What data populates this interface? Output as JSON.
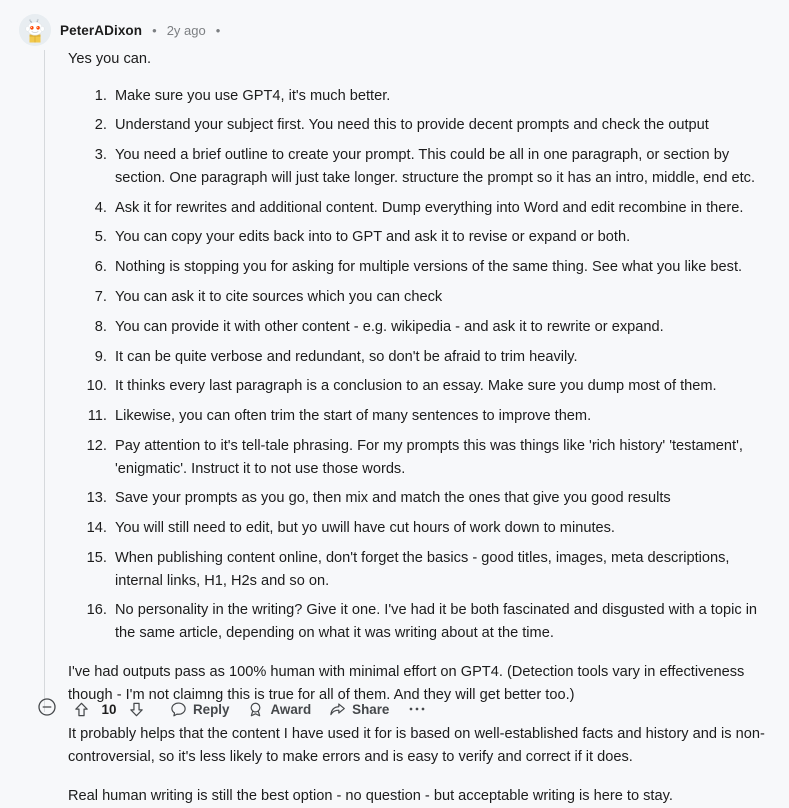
{
  "comment": {
    "author": "PeterADixon",
    "separator": "•",
    "timestamp": "2y ago",
    "avatar_icon": "reddit-snoo-avatar"
  },
  "body": {
    "intro": "Yes you can.",
    "list_items": [
      "Make sure you use GPT4, it's much better.",
      "Understand your subject first. You need this to provide decent prompts and check the output",
      "You need a brief outline to create your prompt. This could be all in one paragraph, or section by section. One paragraph will just take longer. structure the prompt so it has an intro, middle, end etc.",
      "Ask it for rewrites and additional content. Dump everything into Word and edit recombine in there.",
      "You can copy your edits back into to GPT and ask it to revise or expand or both.",
      "Nothing is stopping you for asking for multiple versions of the same thing. See what you like best.",
      "You can ask it to cite sources which you can check",
      "You can provide it with other content - e.g. wikipedia - and ask it to rewrite or expand.",
      "It can be quite verbose and redundant, so don't be afraid to trim heavily.",
      "It thinks every last paragraph is a conclusion to an essay. Make sure you dump most of them.",
      "Likewise, you can often trim the start of many sentences to improve them.",
      "Pay attention to it's tell-tale phrasing. For my prompts this was things like 'rich history' 'testament', 'enigmatic'. Instruct it to not use those words.",
      "Save your prompts as you go, then mix and match the ones that give you good results",
      "You will still need to edit, but yo uwill have cut hours of work down to minutes.",
      "When publishing content online, don't forget the basics - good titles, images, meta descriptions, internal links, H1, H2s and so on.",
      "No personality in the writing? Give it one. I've had it be both fascinated and disgusted with a topic in the same article, depending on what it was writing about at the time."
    ],
    "paragraphs": [
      "I've had outputs pass as 100% human with minimal effort on GPT4. (Detection tools vary in effectiveness though - I'm not claimng this is true for all of them. And they will get better too.)",
      "It probably helps that the content I have used it for is based on well-established facts and history and is non-controversial, so it's less likely to make errors and is easy to verify and correct if it does.",
      "Real human writing is still the best option - no question - but acceptable writing is here to stay."
    ]
  },
  "actions": {
    "collapse_icon": "minus-circle-icon",
    "upvote_icon": "upvote-arrow-icon",
    "downvote_icon": "downvote-arrow-icon",
    "vote_count": "10",
    "reply_label": "Reply",
    "reply_icon": "comment-bubble-icon",
    "award_label": "Award",
    "award_icon": "award-medal-icon",
    "share_label": "Share",
    "share_icon": "share-arrow-icon",
    "more_label": "•••",
    "more_icon": "overflow-menu-icon"
  },
  "colors": {
    "background": "#f7f8fa",
    "text": "#1c1c1c",
    "meta_text": "#7c7f82",
    "thread_line": "#d6d9dc",
    "action_text": "#45484b"
  }
}
